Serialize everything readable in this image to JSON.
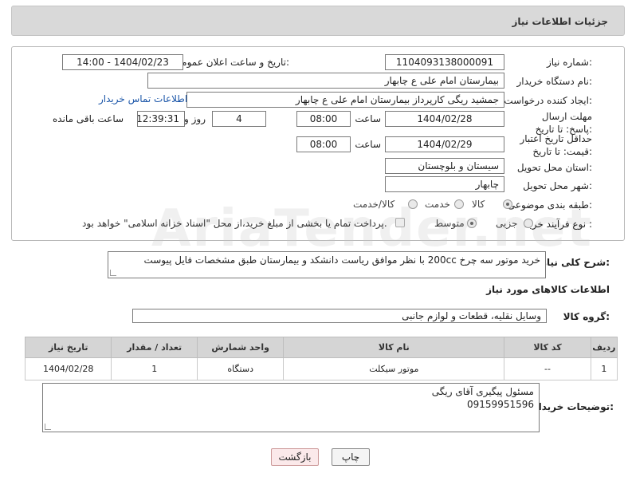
{
  "header": {
    "title": "جزئیات اطلاعات نیاز"
  },
  "fields": {
    "need_number_label": "شماره نیاز:",
    "need_number": "1104093138000091",
    "announce_label": "تاریخ و ساعت اعلان عمومی:",
    "announce_value": "1404/02/23 - 14:00",
    "buyer_org_label": "نام دستگاه خریدار:",
    "buyer_org": "بیمارستان امام علی  ع  چابهار",
    "creator_label": "ایجاد کننده درخواست:",
    "creator": "جمشید ریگی کارپرداز بیمارستان امام علی  ع  چابهار",
    "contact_link": "اطلاعات تماس خریدار",
    "reply_deadline_label": "مهلت ارسال پاسخ: تا تاریخ:",
    "reply_date": "1404/02/28",
    "time_label": "ساعت",
    "reply_time": "08:00",
    "days_value": "4",
    "days_label": "روز و",
    "remaining_time": "12:39:31",
    "remaining_label": "ساعت باقی مانده",
    "price_validity_label": "حداقل تاریخ اعتبار قیمت: تا تاریخ:",
    "price_date": "1404/02/29",
    "price_time": "08:00",
    "province_label": "استان محل تحویل:",
    "province": "سیستان و بلوچستان",
    "city_label": "شهر محل تحویل:",
    "city": "چابهار",
    "category_label": "طبقه بندی موضوعی:",
    "category_options": [
      "کالا",
      "خدمت",
      "کالا/خدمت"
    ],
    "process_label": "نوع فرآیند خرید :",
    "process_options": [
      "جزیی",
      "متوسط"
    ],
    "payment_note": "پرداخت تمام یا بخشی از مبلغ خرید،از محل \"اسناد خزانه اسلامی\" خواهد بود."
  },
  "description": {
    "label": "شرح کلی نیاز:",
    "text": "خرید موتور سه چرخ 200cc  با نظر موافق ریاست دانشکد و بیمارستان طبق مشخصات فایل پیوست"
  },
  "goods": {
    "section_title": "اطلاعات کالاهای مورد نیاز",
    "group_label": "گروه کالا:",
    "group_value": "وسایل نقلیه، قطعات و لوازم جانبی",
    "columns": [
      "ردیف",
      "کد کالا",
      "نام کالا",
      "واحد شمارش",
      "تعداد / مقدار",
      "تاریخ نیاز"
    ],
    "rows": [
      [
        "1",
        "--",
        "موتور سیکلت",
        "دستگاه",
        "1",
        "1404/02/28"
      ]
    ]
  },
  "buyer_notes": {
    "label": "توضیحات خریدار:",
    "line1": "مسئول پیگیری آقای ریگی",
    "line2": "09159951596"
  },
  "buttons": {
    "print": "چاپ",
    "back": "بازگشت"
  },
  "watermark": "AriaTender.net"
}
